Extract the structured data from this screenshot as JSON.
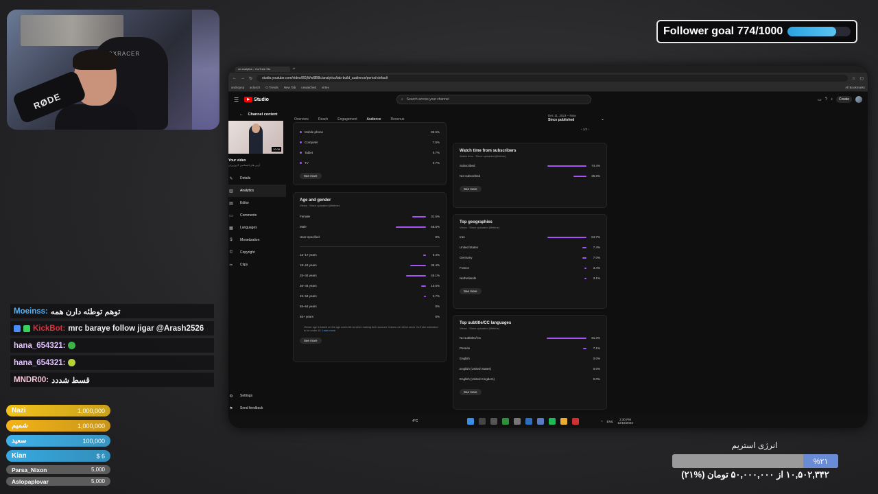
{
  "follower_goal": {
    "label": "Follower goal 774/1000",
    "current": 774,
    "target": 1000,
    "fill_color": "#2aa3e0"
  },
  "webcam": {
    "mic_brand": "RØDE",
    "chair_brand": "DXRACER"
  },
  "browser": {
    "tab_title": "ce analytics - YouTube Stu",
    "url": "studio.youtube.com/video/8GjWwl8B8c/analytics/tab-build_audience/period-default",
    "bookmarks": [
      "androproj",
      "aclusch",
      "G Trends",
      "New Tab",
      "unwatched",
      "virtex"
    ],
    "all_bookmarks": "All Bookmarks"
  },
  "studio": {
    "logo": "Studio",
    "search_placeholder": "Search across your channel",
    "create_label": "Create",
    "channel_content": "Channel content",
    "video_duration": "10:08",
    "your_video": "Your video",
    "video_subtitle": "آی‌پی های اختصاصی ✗ وی‌پی‌ان",
    "nav": [
      "Details",
      "Analytics",
      "Editor",
      "Comments",
      "Languages",
      "Monetization",
      "Copyright",
      "Clips"
    ],
    "nav_icons": [
      "pencil-icon",
      "analytics-icon",
      "editor-icon",
      "comments-icon",
      "languages-icon",
      "monetization-icon",
      "copyright-icon",
      "clips-icon"
    ],
    "bottom_nav": [
      "Settings",
      "Send feedback"
    ],
    "tabs": [
      "Overview",
      "Reach",
      "Engagement",
      "Audience",
      "Revenue"
    ],
    "active_tab": "Audience",
    "date_range_small": "Dec 11, 2023 – Now",
    "date_range": "Since published",
    "pager": "1/3",
    "see_more": "See more"
  },
  "device_card": {
    "rows": [
      {
        "label": "Mobile phone",
        "value": "85.5%"
      },
      {
        "label": "Computer",
        "value": "7.5%"
      },
      {
        "label": "Tablet",
        "value": "0.7%"
      },
      {
        "label": "TV",
        "value": "0.7%"
      }
    ]
  },
  "age_gender": {
    "title": "Age and gender",
    "subtitle": "Views · Since uploaded (lifetime)",
    "gender": [
      {
        "label": "Female",
        "value": "31.5%",
        "fraction": 0.315
      },
      {
        "label": "Male",
        "value": "68.5%",
        "fraction": 0.685
      },
      {
        "label": "User-specified",
        "value": "0%",
        "fraction": 0
      }
    ],
    "ages": [
      {
        "label": "13–17 years",
        "value": "6.4%",
        "fraction": 0.064
      },
      {
        "label": "18–24 years",
        "value": "36.4%",
        "fraction": 0.364
      },
      {
        "label": "25–34 years",
        "value": "46.1%",
        "fraction": 0.461
      },
      {
        "label": "35–44 years",
        "value": "10.5%",
        "fraction": 0.105
      },
      {
        "label": "45–54 years",
        "value": "2.7%",
        "fraction": 0.027
      },
      {
        "label": "55–64 years",
        "value": "0%",
        "fraction": 0
      },
      {
        "label": "65+ years",
        "value": "0%",
        "fraction": 0
      }
    ],
    "note": "Viewer age is based on the age users tell us when making their account. It does not reflect users YouTube estimated to be under 18.",
    "note_link": "Learn more"
  },
  "subscribers_card": {
    "title": "Watch time from subscribers",
    "subtitle": "Watch time · Since uploaded (lifetime)",
    "rows": [
      {
        "label": "Subscribed",
        "value": "74.4%",
        "fraction": 0.744
      },
      {
        "label": "Not subscribed",
        "value": "25.6%",
        "fraction": 0.256
      }
    ]
  },
  "geo_card": {
    "title": "Top geographies",
    "subtitle": "Views · Since uploaded (lifetime)",
    "rows": [
      {
        "label": "Iran",
        "value": "64.7%",
        "fraction": 0.647
      },
      {
        "label": "United States",
        "value": "7.4%",
        "fraction": 0.074
      },
      {
        "label": "Germany",
        "value": "7.0%",
        "fraction": 0.07
      },
      {
        "label": "France",
        "value": "3.4%",
        "fraction": 0.034
      },
      {
        "label": "Netherlands",
        "value": "3.1%",
        "fraction": 0.031
      }
    ]
  },
  "lang_card": {
    "title": "Top subtitle/CC languages",
    "subtitle": "Views · Since uploaded (lifetime)",
    "rows": [
      {
        "label": "No subtitles/CC",
        "value": "91.3%",
        "fraction": 0.913
      },
      {
        "label": "Persian",
        "value": "7.1%",
        "fraction": 0.071
      },
      {
        "label": "English",
        "value": "0.0%",
        "fraction": 0.0
      },
      {
        "label": "English (United States)",
        "value": "0.0%",
        "fraction": 0.0
      },
      {
        "label": "English (United Kingdom)",
        "value": "0.0%",
        "fraction": 0.0
      }
    ]
  },
  "taskbar": {
    "weather": "4°C",
    "lang": "ENG",
    "time": "2:30 PM",
    "date": "12/18/2023"
  },
  "chat": [
    {
      "user": "Moeinss:",
      "color": "#4fb3ff",
      "text": "توهم توطئه دارن همه"
    },
    {
      "user": "KickBot:",
      "color": "#e0303a",
      "text": "mrc baraye follow jigar @Arash2526",
      "badges": true
    },
    {
      "user": "hana_654321:",
      "color": "#e2c3ff",
      "text": ""
    },
    {
      "user": "hana_654321:",
      "color": "#e2c3ff",
      "text": ""
    },
    {
      "user": "MNDR00:",
      "color": "#f6c7d7",
      "text": "قسط شددد"
    }
  ],
  "donors": [
    {
      "name": "Nazi",
      "amount": "1,000,000",
      "color": "#f3c21b"
    },
    {
      "name": "شمیم",
      "amount": "1,000,000",
      "color": "#f3b318"
    },
    {
      "name": "سعید",
      "amount": "100,000",
      "color": "#3fb1e8"
    },
    {
      "name": "Kian",
      "amount": "$ 6",
      "color": "#37a9e0"
    },
    {
      "name": "Parsa_Nixon",
      "amount": "5,000",
      "color": "#5c5c5c",
      "small": true
    },
    {
      "name": "Aslopaplovar",
      "amount": "5,000",
      "color": "#5c5c5c",
      "small": true
    }
  ],
  "energy": {
    "title": "انرژی استریم",
    "percent_label": "%۲۱",
    "fraction": 0.21,
    "text": "۱۰,۵۰۲,۳۴۲ از ۵۰,۰۰۰,۰۰۰ تومان (%۲۱)"
  }
}
